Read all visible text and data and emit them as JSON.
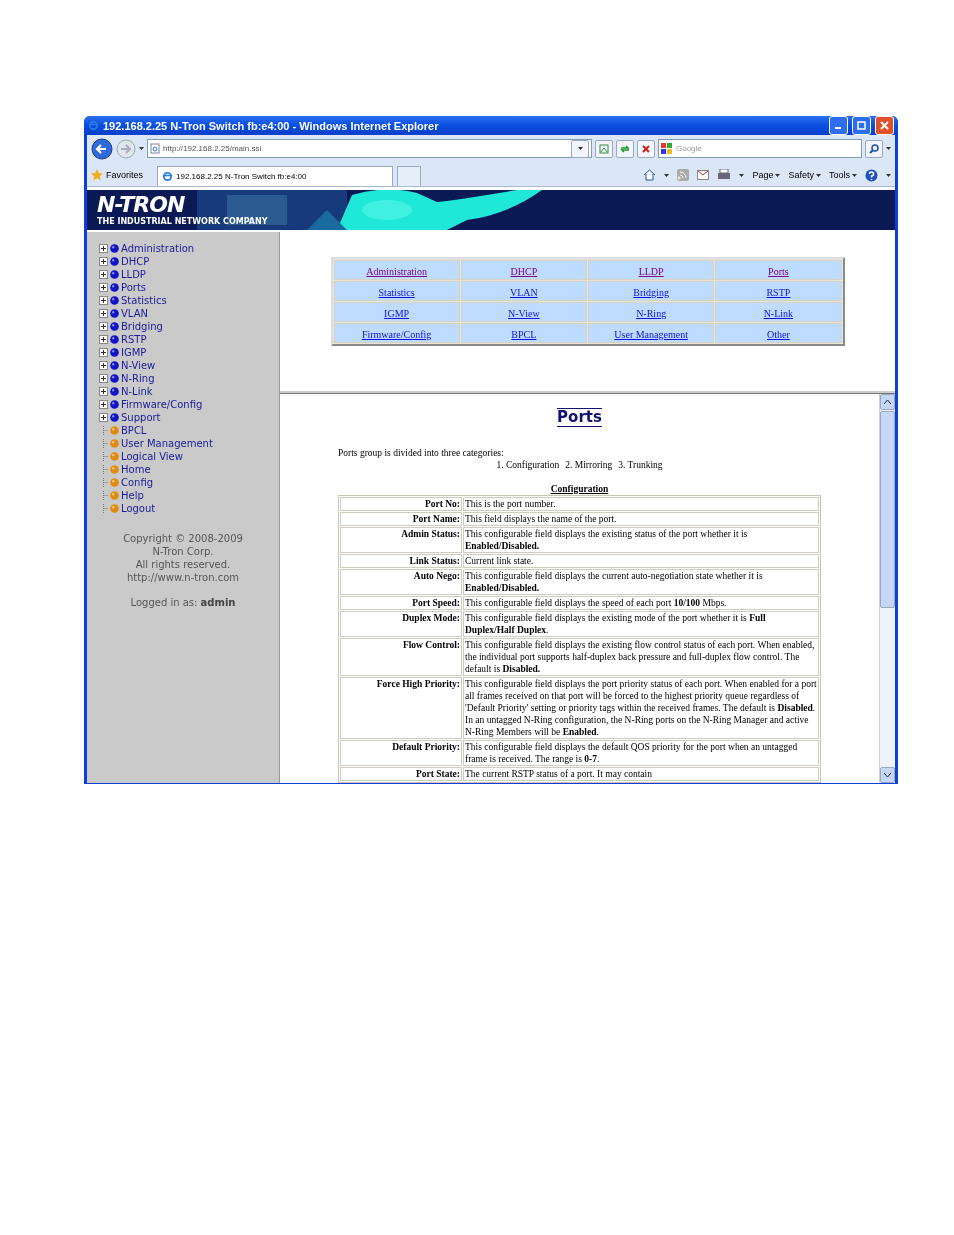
{
  "window": {
    "title": "192.168.2.25 N-Tron Switch fb:e4:00 - Windows Internet Explorer"
  },
  "toolbar": {
    "address": "http://192.168.2.25/main.ssi",
    "search": {
      "placeholder": "Google"
    }
  },
  "favorites_bar": {
    "favorites": "Favorites",
    "tabs": [
      {
        "label": "192.168.2.25 N-Tron Switch fb:e4:00",
        "selected": true
      }
    ],
    "commands": [
      "Page",
      "Safety",
      "Tools"
    ]
  },
  "banner": {
    "logo": "N-TRON",
    "tagline": "THE INDUSTRIAL NETWORK COMPANY"
  },
  "sidebar": {
    "items": [
      {
        "label": "Administration",
        "kind": "folder"
      },
      {
        "label": "DHCP",
        "kind": "folder"
      },
      {
        "label": "LLDP",
        "kind": "folder"
      },
      {
        "label": "Ports",
        "kind": "folder"
      },
      {
        "label": "Statistics",
        "kind": "folder"
      },
      {
        "label": "VLAN",
        "kind": "folder"
      },
      {
        "label": "Bridging",
        "kind": "folder"
      },
      {
        "label": "RSTP",
        "kind": "folder"
      },
      {
        "label": "IGMP",
        "kind": "folder"
      },
      {
        "label": "N-View",
        "kind": "folder"
      },
      {
        "label": "N-Ring",
        "kind": "folder"
      },
      {
        "label": "N-Link",
        "kind": "folder"
      },
      {
        "label": "Firmware/Config",
        "kind": "folder"
      },
      {
        "label": "Support",
        "kind": "folder"
      },
      {
        "label": "BPCL",
        "kind": "page"
      },
      {
        "label": "User Management",
        "kind": "page"
      },
      {
        "label": "Logical View",
        "kind": "page"
      },
      {
        "label": "Home",
        "kind": "page"
      },
      {
        "label": "Config",
        "kind": "page"
      },
      {
        "label": "Help",
        "kind": "page"
      },
      {
        "label": "Logout",
        "kind": "page"
      }
    ],
    "footer": [
      "Copyright © 2008-2009",
      "N-Tron Corp.",
      "All rights reserved.",
      "http://www.n-tron.com"
    ],
    "login": "Logged in as: **admin**"
  },
  "nav_table": {
    "rows": [
      [
        {
          "label": "Administration",
          "visited": true
        },
        {
          "label": "DHCP",
          "visited": true
        },
        {
          "label": "LLDP",
          "visited": true
        },
        {
          "label": "Ports",
          "visited": true
        }
      ],
      [
        {
          "label": "Statistics",
          "visited": false
        },
        {
          "label": "VLAN",
          "visited": false
        },
        {
          "label": "Bridging",
          "visited": false
        },
        {
          "label": "RSTP",
          "visited": false
        }
      ],
      [
        {
          "label": "IGMP",
          "visited": false
        },
        {
          "label": "N-View",
          "visited": false
        },
        {
          "label": "N-Ring",
          "visited": false
        },
        {
          "label": "N-Link",
          "visited": false
        }
      ],
      [
        {
          "label": "Firmware/Config",
          "visited": false
        },
        {
          "label": "BPCL",
          "visited": false
        },
        {
          "label": "User Management",
          "visited": false
        },
        {
          "label": "Other",
          "visited": false
        }
      ]
    ]
  },
  "content": {
    "title": "Ports",
    "intro": "Ports group is divided into three categories:",
    "categories": [
      "1. Configuration",
      "2. Mirroring",
      "3. Trunking"
    ],
    "section": "Configuration",
    "rows": [
      {
        "field": "Port No:",
        "description": "This is the port number."
      },
      {
        "field": "Port Name:",
        "description": "This field displays the name of the port."
      },
      {
        "field": "Admin Status:",
        "description": "This configurable field displays the existing status of the port whether it is **Enabled/Disabled.**"
      },
      {
        "field": "Link Status:",
        "description": "Current link state."
      },
      {
        "field": "Auto Nego:",
        "description": "This configurable field displays the current auto-negotiation state whether it is **Enabled/Disabled.**"
      },
      {
        "field": "Port Speed:",
        "description": "This configurable field displays the speed of each port **10/100** Mbps."
      },
      {
        "field": "Duplex Mode:",
        "description": "This configurable field displays the existing mode of the port whether it is **Full Duplex/Half Duplex**."
      },
      {
        "field": "Flow Control:",
        "description": "This configurable field displays the existing flow control status of each port. When enabled, the individual port supports half-duplex back pressure and full-duplex flow control. The default is **Disabled.**"
      },
      {
        "field": "Force High Priority:",
        "description": "This configurable field displays the port priority status of each port. When enabled for a port all frames received on that port will be forced to the highest priority queue regardless of 'Default Priority' setting or priority tags within the received frames. The default is **Disabled**. In an untagged N-Ring configuration, the N-Ring ports on the N-Ring Manager and active N-Ring Members will be **Enabled**."
      },
      {
        "field": "Default Priority:",
        "description": "This configurable field displays the default QOS priority for the port when an untagged frame is received. The range is **0-7**."
      },
      {
        "field": "Port State:",
        "description": "The current RSTP status of a port. It may contain"
      }
    ]
  }
}
